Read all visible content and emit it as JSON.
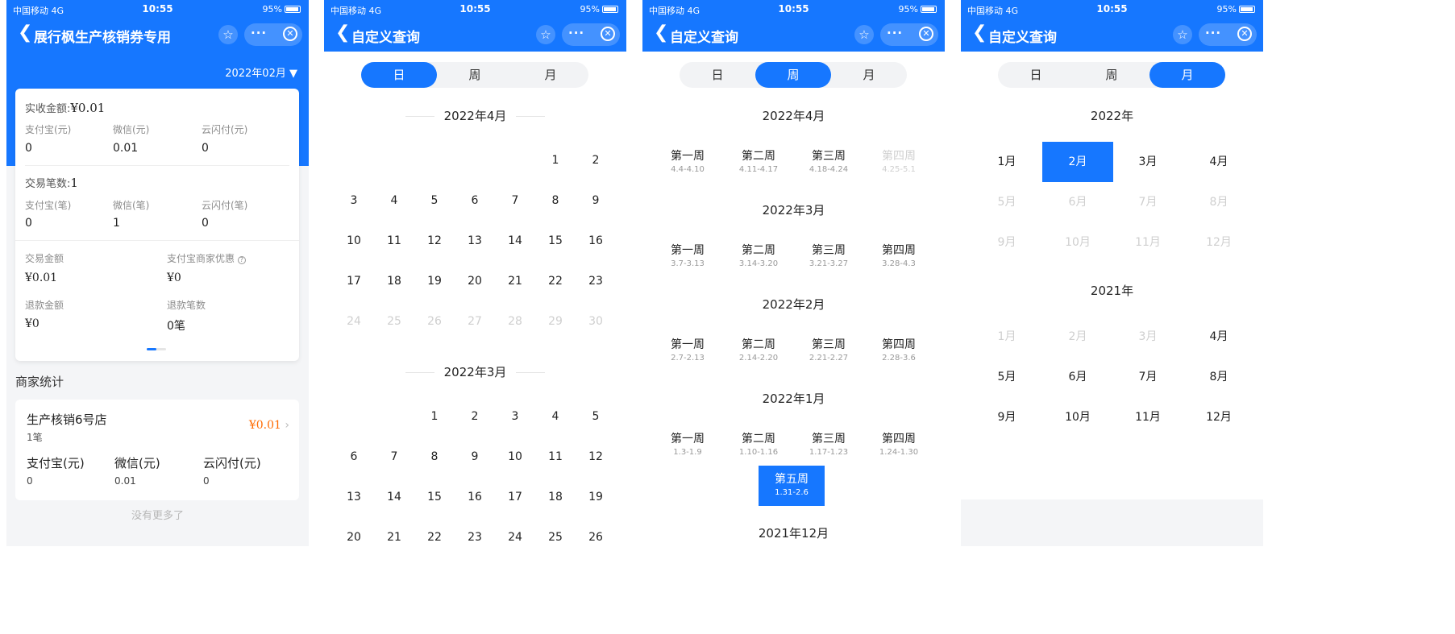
{
  "status": {
    "signal": "中国移动 4G",
    "time": "10:55",
    "battery": "95%"
  },
  "icons": {
    "back": "chevron-left-icon",
    "star": "star-icon",
    "more": "more-dots-icon",
    "close": "close-circle-icon"
  },
  "colors": {
    "primary": "#1677ff",
    "accent": "#ff6a00"
  },
  "screen1": {
    "title": "展行枫生产核销券专用",
    "month": "2022年02月",
    "received_label": "实收金额:",
    "received_value": "¥0.01",
    "pay_labels": [
      "支付宝(元)",
      "微信(元)",
      "云闪付(元)"
    ],
    "pay_values": [
      "0",
      "0.01",
      "0"
    ],
    "tx_count_label": "交易笔数:",
    "tx_count_value": "1",
    "cnt_labels": [
      "支付宝(笔)",
      "微信(笔)",
      "云闪付(笔)"
    ],
    "cnt_values": [
      "0",
      "1",
      "0"
    ],
    "tx_amount_label": "交易金额",
    "tx_amount_value": "¥0.01",
    "discount_label": "支付宝商家优惠",
    "discount_value": "¥0",
    "refund_amount_label": "退款金额",
    "refund_amount_value": "¥0",
    "refund_count_label": "退款笔数",
    "refund_count_value": "0笔",
    "merchant_section": "商家统计",
    "shop_name": "生产核销6号店",
    "shop_count": "1笔",
    "shop_amount": "¥0.01",
    "shop_labels": [
      "支付宝(元)",
      "微信(元)",
      "云闪付(元)"
    ],
    "shop_values": [
      "0",
      "0.01",
      "0"
    ],
    "no_more": "没有更多了"
  },
  "query_title": "自定义查询",
  "tabs": [
    "日",
    "周",
    "月"
  ],
  "screen2": {
    "months": [
      {
        "title": "2022年4月",
        "rows": [
          [
            {
              "d": "",
              "dim": false
            },
            {
              "d": "",
              "dim": false
            },
            {
              "d": "",
              "dim": false
            },
            {
              "d": "",
              "dim": false
            },
            {
              "d": "",
              "dim": false
            },
            {
              "d": "1",
              "dim": false
            },
            {
              "d": "2",
              "dim": false
            }
          ],
          [
            {
              "d": "3",
              "dim": false
            },
            {
              "d": "4",
              "dim": false
            },
            {
              "d": "5",
              "dim": false
            },
            {
              "d": "6",
              "dim": false
            },
            {
              "d": "7",
              "dim": false
            },
            {
              "d": "8",
              "dim": false
            },
            {
              "d": "9",
              "dim": false
            }
          ],
          [
            {
              "d": "10",
              "dim": false
            },
            {
              "d": "11",
              "dim": false
            },
            {
              "d": "12",
              "dim": false
            },
            {
              "d": "13",
              "dim": false
            },
            {
              "d": "14",
              "dim": false
            },
            {
              "d": "15",
              "dim": false
            },
            {
              "d": "16",
              "dim": false
            }
          ],
          [
            {
              "d": "17",
              "dim": false
            },
            {
              "d": "18",
              "dim": false
            },
            {
              "d": "19",
              "dim": false
            },
            {
              "d": "20",
              "dim": false
            },
            {
              "d": "21",
              "dim": false
            },
            {
              "d": "22",
              "dim": false
            },
            {
              "d": "23",
              "dim": false
            }
          ],
          [
            {
              "d": "24",
              "dim": true
            },
            {
              "d": "25",
              "dim": true
            },
            {
              "d": "26",
              "dim": true
            },
            {
              "d": "27",
              "dim": true
            },
            {
              "d": "28",
              "dim": true
            },
            {
              "d": "29",
              "dim": true
            },
            {
              "d": "30",
              "dim": true
            }
          ]
        ]
      },
      {
        "title": "2022年3月",
        "rows": [
          [
            {
              "d": "",
              "dim": false
            },
            {
              "d": "",
              "dim": false
            },
            {
              "d": "1",
              "dim": false
            },
            {
              "d": "2",
              "dim": false
            },
            {
              "d": "3",
              "dim": false
            },
            {
              "d": "4",
              "dim": false
            },
            {
              "d": "5",
              "dim": false
            }
          ],
          [
            {
              "d": "6",
              "dim": false
            },
            {
              "d": "7",
              "dim": false
            },
            {
              "d": "8",
              "dim": false
            },
            {
              "d": "9",
              "dim": false
            },
            {
              "d": "10",
              "dim": false
            },
            {
              "d": "11",
              "dim": false
            },
            {
              "d": "12",
              "dim": false
            }
          ],
          [
            {
              "d": "13",
              "dim": false
            },
            {
              "d": "14",
              "dim": false
            },
            {
              "d": "15",
              "dim": false
            },
            {
              "d": "16",
              "dim": false
            },
            {
              "d": "17",
              "dim": false
            },
            {
              "d": "18",
              "dim": false
            },
            {
              "d": "19",
              "dim": false
            }
          ],
          [
            {
              "d": "20",
              "dim": false
            },
            {
              "d": "21",
              "dim": false
            },
            {
              "d": "22",
              "dim": false
            },
            {
              "d": "23",
              "dim": false
            },
            {
              "d": "24",
              "dim": false
            },
            {
              "d": "25",
              "dim": false
            },
            {
              "d": "26",
              "dim": false
            }
          ]
        ]
      }
    ]
  },
  "screen3": {
    "groups": [
      {
        "title": "2022年4月",
        "weeks": [
          {
            "name": "第一周",
            "range": "4.4-4.10",
            "state": "normal"
          },
          {
            "name": "第二周",
            "range": "4.11-4.17",
            "state": "normal"
          },
          {
            "name": "第三周",
            "range": "4.18-4.24",
            "state": "normal"
          },
          {
            "name": "第四周",
            "range": "4.25-5.1",
            "state": "dim"
          }
        ]
      },
      {
        "title": "2022年3月",
        "weeks": [
          {
            "name": "第一周",
            "range": "3.7-3.13",
            "state": "normal"
          },
          {
            "name": "第二周",
            "range": "3.14-3.20",
            "state": "normal"
          },
          {
            "name": "第三周",
            "range": "3.21-3.27",
            "state": "normal"
          },
          {
            "name": "第四周",
            "range": "3.28-4.3",
            "state": "normal"
          }
        ]
      },
      {
        "title": "2022年2月",
        "weeks": [
          {
            "name": "第一周",
            "range": "2.7-2.13",
            "state": "normal"
          },
          {
            "name": "第二周",
            "range": "2.14-2.20",
            "state": "normal"
          },
          {
            "name": "第三周",
            "range": "2.21-2.27",
            "state": "normal"
          },
          {
            "name": "第四周",
            "range": "2.28-3.6",
            "state": "normal"
          }
        ]
      },
      {
        "title": "2022年1月",
        "weeks": [
          {
            "name": "第一周",
            "range": "1.3-1.9",
            "state": "normal"
          },
          {
            "name": "第二周",
            "range": "1.10-1.16",
            "state": "normal"
          },
          {
            "name": "第三周",
            "range": "1.17-1.23",
            "state": "normal"
          },
          {
            "name": "第四周",
            "range": "1.24-1.30",
            "state": "normal"
          },
          {
            "name": "第五周",
            "range": "1.31-2.6",
            "state": "selected"
          }
        ]
      },
      {
        "title": "2021年12月",
        "weeks": []
      }
    ]
  },
  "screen4": {
    "years": [
      {
        "title": "2022年",
        "months": [
          {
            "m": "1月",
            "state": "normal"
          },
          {
            "m": "2月",
            "state": "selected"
          },
          {
            "m": "3月",
            "state": "normal"
          },
          {
            "m": "4月",
            "state": "normal"
          },
          {
            "m": "5月",
            "state": "dim"
          },
          {
            "m": "6月",
            "state": "dim"
          },
          {
            "m": "7月",
            "state": "dim"
          },
          {
            "m": "8月",
            "state": "dim"
          },
          {
            "m": "9月",
            "state": "dim"
          },
          {
            "m": "10月",
            "state": "dim"
          },
          {
            "m": "11月",
            "state": "dim"
          },
          {
            "m": "12月",
            "state": "dim"
          }
        ]
      },
      {
        "title": "2021年",
        "months": [
          {
            "m": "1月",
            "state": "dim"
          },
          {
            "m": "2月",
            "state": "dim"
          },
          {
            "m": "3月",
            "state": "dim"
          },
          {
            "m": "4月",
            "state": "normal"
          },
          {
            "m": "5月",
            "state": "normal"
          },
          {
            "m": "6月",
            "state": "normal"
          },
          {
            "m": "7月",
            "state": "normal"
          },
          {
            "m": "8月",
            "state": "normal"
          },
          {
            "m": "9月",
            "state": "normal"
          },
          {
            "m": "10月",
            "state": "normal"
          },
          {
            "m": "11月",
            "state": "normal"
          },
          {
            "m": "12月",
            "state": "normal"
          }
        ]
      }
    ]
  }
}
